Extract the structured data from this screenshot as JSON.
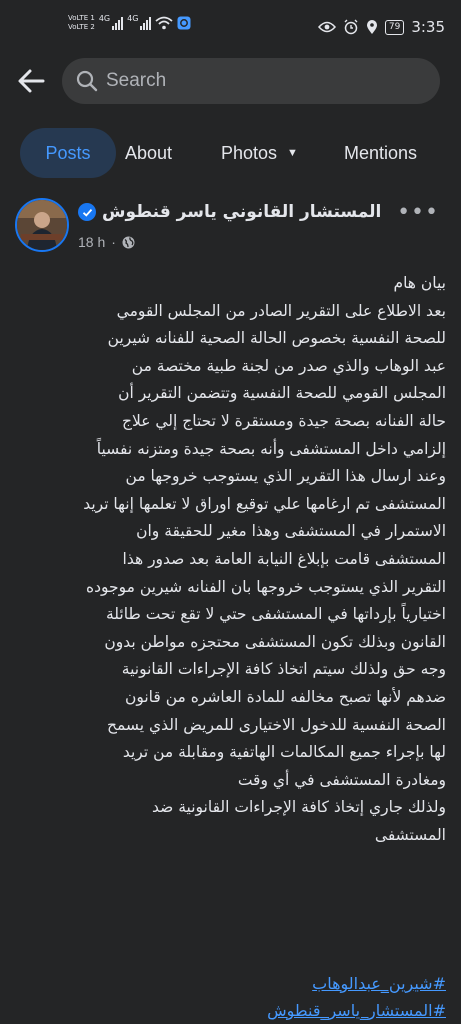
{
  "status_bar": {
    "sim1": "VoLTE 1",
    "sim2": "VoLTE 2",
    "network1": "4G",
    "network2": "4G",
    "battery": "79",
    "time": "3:35"
  },
  "topbar": {
    "search_placeholder": "Search"
  },
  "tabs": [
    {
      "label": "Posts",
      "active": true
    },
    {
      "label": "About",
      "active": false
    },
    {
      "label": "Photos",
      "active": false
    },
    {
      "label": "Mentions",
      "active": false
    }
  ],
  "post": {
    "author": "المستشار القانوني  ياسر قنطوش",
    "time": "18 h",
    "visibility_icon": "globe-icon",
    "lines": [
      "بيان هام",
      "بعد الاطلاع على التقرير الصادر من المجلس القومي",
      "للصحة النفسية بخصوص الحالة الصحية  للفنانه شيرين",
      "عبد الوهاب  والذي صدر من لجنة طبية مختصة  من",
      "المجلس القومي للصحة النفسية  وتتضمن التقرير أن",
      "حالة الفنانه بصحة جيدة ومستقرة لا تحتاج  إلي علاج",
      "إلزامي داخل المستشفى وأنه بصحة جيدة ومتزنه نفسياً",
      "وعند ارسال هذا التقرير الذي يستوجب خروجها من",
      "المستشفى تم ارغامها علي توقيع اوراق لا تعلمها إنها تريد",
      "الاستمرار في المستشفى وهذا مغير للحقيقة وان",
      "المستشفى قامت بإبلاغ النيابة العامة بعد صدور هذا",
      "التقرير الذي يستوجب خروجها بان الفنانه شيرين موجوده",
      "اختيارياً بإرداتها في المستشفى حتي لا تقع تحت طائلة",
      "القانون  وبذلك تكون المستشفى محتجزه مواطن بدون",
      "وجه حق ولذلك سيتم اتخاذ كافة الإجراءات القانونية",
      "ضدهم لأنها تصبح مخالفه للمادة العاشره من قانون",
      "الصحة النفسية للدخول الاختيارى للمريض الذي يسمح",
      "لها بإجراء جميع المكالمات الهاتفية ومقابلة من تريد",
      "ومغادرة المستشفى في أي وقت",
      "ولذلك جاري إتخاذ كافة الإجراءات القانونية ضد",
      "المستشفى"
    ],
    "hashtags": [
      "#شيرين_عبدالوهاب",
      "#المستشار_ياسر_قنطوش"
    ]
  },
  "colors": {
    "background": "#242526",
    "search_bg": "#3a3b3c",
    "active_tab_bg": "#263951",
    "accent": "#4599ff",
    "verified": "#1877f2"
  }
}
